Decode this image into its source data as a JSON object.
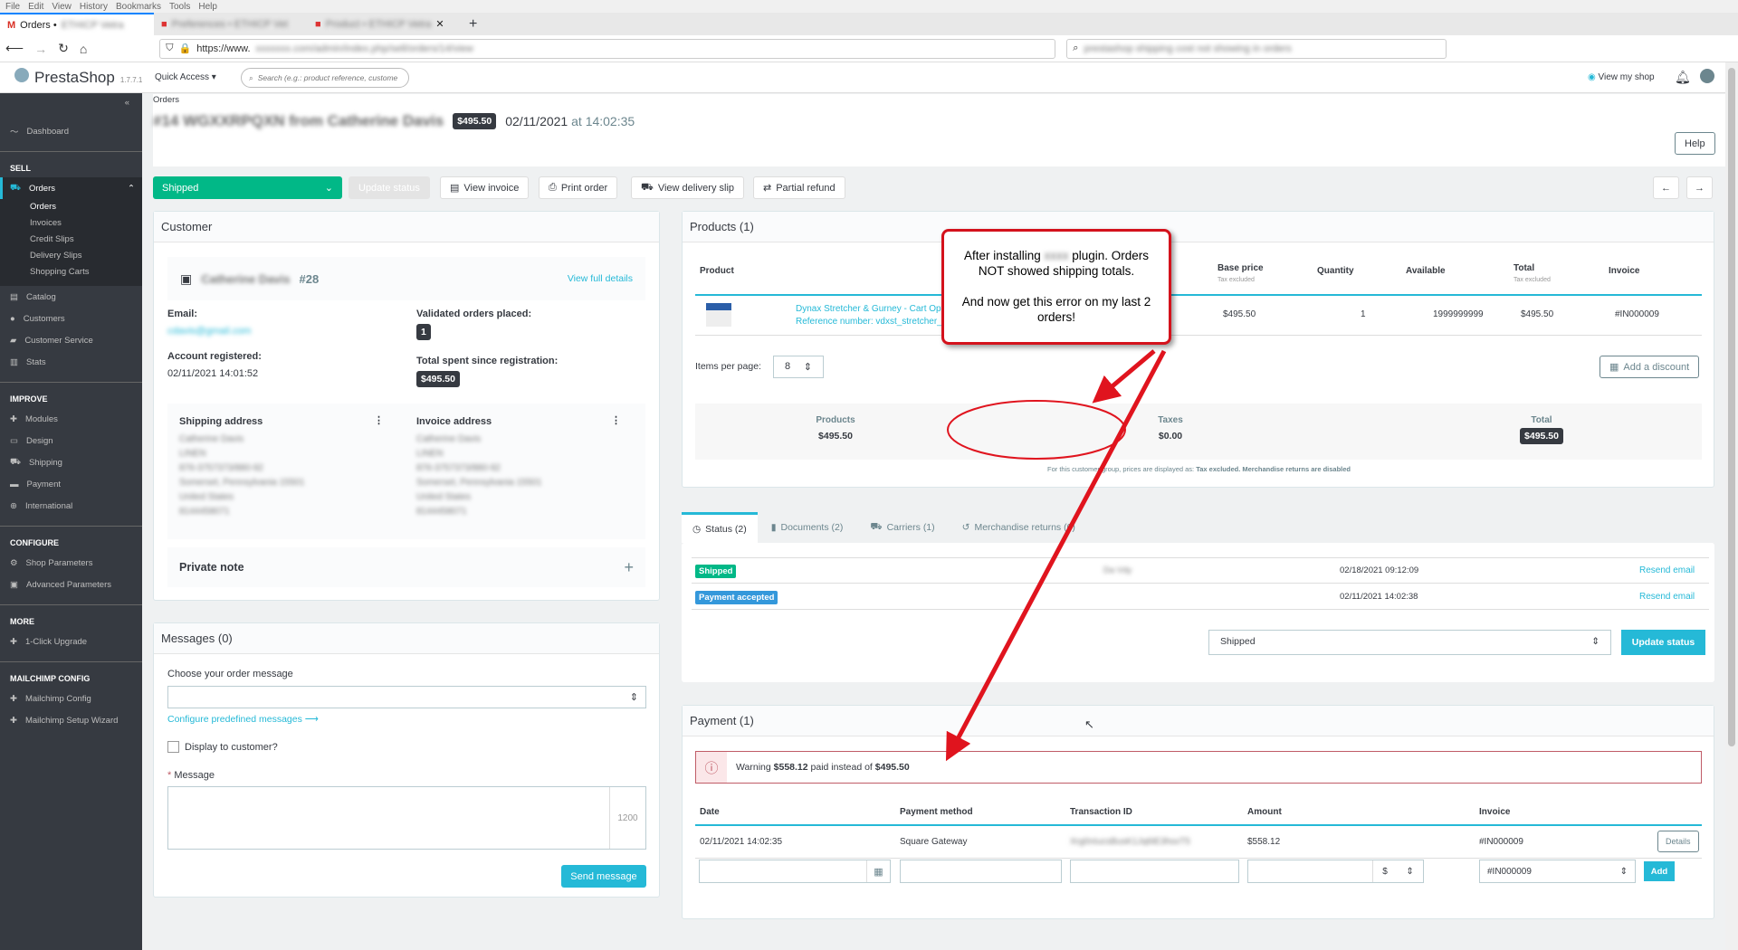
{
  "browser": {
    "menu": [
      "File",
      "Edit",
      "View",
      "History",
      "Bookmarks",
      "Tools",
      "Help"
    ],
    "tabs": [
      {
        "label": "Orders •",
        "blurred": "ETHICP Vetra"
      },
      {
        "label": "",
        "blurred": "Preferences • ETHICP Vet"
      },
      {
        "label": "",
        "blurred": "Product • ETHICP Vetra"
      }
    ],
    "url_prefix": "https://www.",
    "search_value": "prestashop shipping cost not showing in orders"
  },
  "header": {
    "logo": "PrestaShop",
    "version": "1.7.7.1",
    "quick_access": "Quick Access",
    "search_placeholder": "Search (e.g.: product reference, custome",
    "view_shop": "View my shop"
  },
  "sidebar": {
    "dashboard": "Dashboard",
    "sections": [
      {
        "title": "SELL",
        "items": [
          "Orders",
          "Catalog",
          "Customers",
          "Customer Service",
          "Stats"
        ]
      },
      {
        "title": "IMPROVE",
        "items": [
          "Modules",
          "Design",
          "Shipping",
          "Payment",
          "International"
        ]
      },
      {
        "title": "CONFIGURE",
        "items": [
          "Shop Parameters",
          "Advanced Parameters"
        ]
      },
      {
        "title": "MORE",
        "items": [
          "1-Click Upgrade"
        ]
      },
      {
        "title": "MAILCHIMP CONFIG",
        "items": [
          "Mailchimp Config",
          "Mailchimp Setup Wizard"
        ]
      }
    ],
    "orders_sub": [
      "Orders",
      "Invoices",
      "Credit Slips",
      "Delivery Slips",
      "Shopping Carts"
    ]
  },
  "page": {
    "breadcrumb": "Orders",
    "title_blurred": "#14 WGXXRPQXN from Catherine Davis",
    "total": "$495.50",
    "date": "02/11/2021",
    "at": "at",
    "time": "14:02:35",
    "help": "Help"
  },
  "toolbar": {
    "status": "Shipped",
    "update": "Update status",
    "view_invoice": "View invoice",
    "print": "Print order",
    "delivery": "View delivery slip",
    "refund": "Partial refund"
  },
  "customer": {
    "title": "Customer",
    "name_blurred": "Catherine Davis",
    "id": "#28",
    "view_full": "View full details",
    "email_label": "Email:",
    "email_blurred": "cdavis@gmail.com",
    "registered_label": "Account registered:",
    "registered": "02/11/2021 14:01:52",
    "validated_label": "Validated orders placed:",
    "validated": "1",
    "spent_label": "Total spent since registration:",
    "spent": "$495.50",
    "shipping_label": "Shipping address",
    "invoice_label": "Invoice address",
    "address_blurred": [
      "Catherine Davis",
      "LINEN",
      "876-3757373/880-92",
      "Somerset, Pennsylvania 15501",
      "United States",
      "8144458071"
    ],
    "private_note": "Private note"
  },
  "messages": {
    "title": "Messages (0)",
    "choose": "Choose your order message",
    "configure": "Configure predefined messages",
    "display": "Display to customer?",
    "message_label": "Message",
    "counter": "1200",
    "send": "Send message"
  },
  "products": {
    "title": "Products (1)",
    "headers": [
      "Product",
      "Base price",
      "Quantity",
      "Available",
      "Total",
      "Invoice"
    ],
    "tax_excl": "Tax excluded",
    "row": {
      "name": "Dynax Stretcher & Gurney - Cart Opti",
      "ref": "Reference number: vdxst_stretcher_1",
      "base": "$495.50",
      "qty": "1",
      "available": "1999999999",
      "total": "$495.50",
      "invoice": "#IN000009"
    },
    "items_per_page": "Items per page:",
    "ipp_value": "8",
    "add_discount": "Add a discount",
    "summary": {
      "products_label": "Products",
      "products": "$495.50",
      "taxes_label": "Taxes",
      "taxes": "$0.00",
      "total_label": "Total",
      "total": "$495.50"
    },
    "note": "For this customer group, prices are displayed as:",
    "note_b1": "Tax excluded.",
    "note_b2": "Merchandise returns are disabled"
  },
  "tabs": [
    "Status (2)",
    "Documents (2)",
    "Carriers (1)",
    "Merchandise returns (0)"
  ],
  "status": {
    "rows": [
      {
        "badge": "Shipped",
        "color": "#01b887",
        "user_blurred": "Da Vdy",
        "date": "02/18/2021 09:12:09",
        "action": "Resend email"
      },
      {
        "badge": "Payment accepted",
        "color": "#3498db",
        "user_blurred": "",
        "date": "02/11/2021 14:02:38",
        "action": "Resend email"
      }
    ],
    "select": "Shipped",
    "update": "Update status"
  },
  "payment": {
    "title": "Payment (1)",
    "warning_pre": "Warning",
    "warning_paid": "$558.12",
    "warning_mid": "paid instead of",
    "warning_expected": "$495.50",
    "headers": [
      "Date",
      "Payment method",
      "Transaction ID",
      "Amount",
      "Invoice"
    ],
    "row": {
      "date": "02/11/2021 14:02:35",
      "method": "Square Gateway",
      "txn_blurred": "Xrg0nIucsBusK1Jq6tE3hsxT5",
      "amount": "$558.12",
      "invoice": "#IN000009",
      "details": "Details"
    },
    "currency": "$",
    "invoice_select": "#IN000009",
    "add": "Add"
  },
  "annotation": {
    "line1": "After installing",
    "blurred": "xxxx",
    "line1b": "plugin. Orders NOT showed shipping totals.",
    "line2": "And now get this error on my last 2 orders!",
    "color": "#e0141e"
  },
  "colors": {
    "accent": "#25b9d7",
    "sidebar": "#363a41",
    "success": "#01b887",
    "danger": "#c05c67"
  }
}
